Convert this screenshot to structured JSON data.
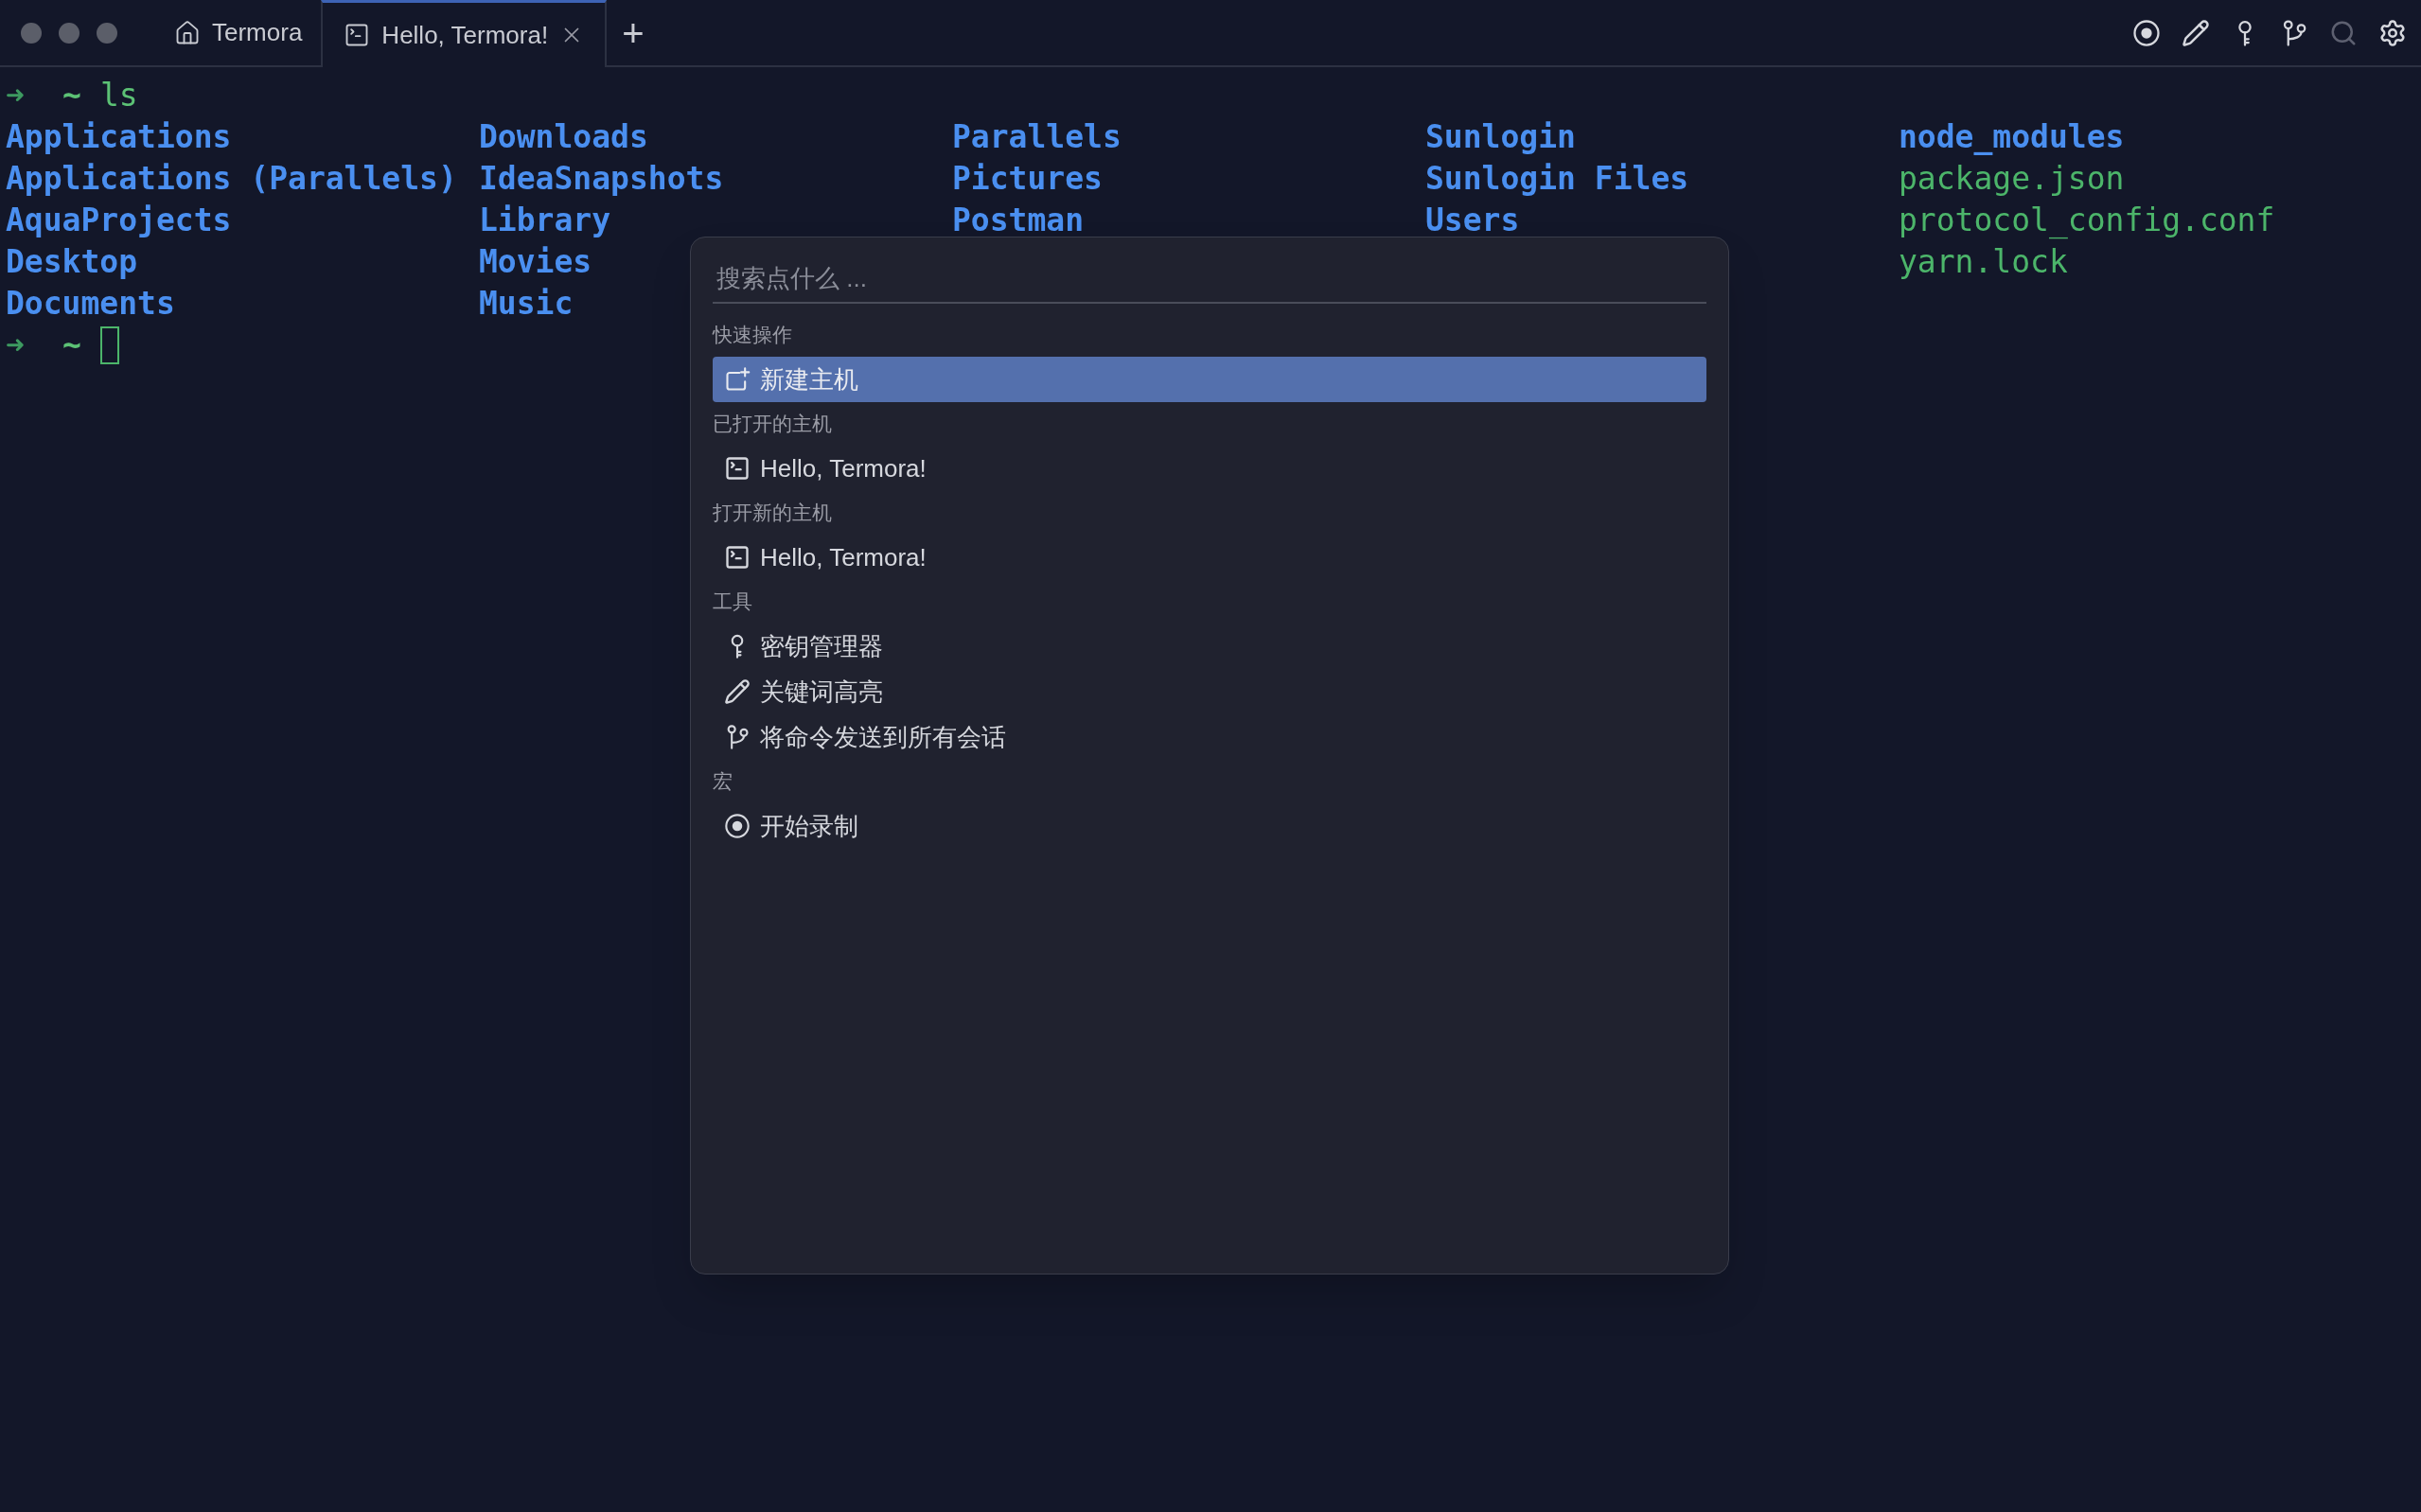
{
  "tabs": [
    {
      "kind": "home",
      "label": "Termora",
      "selected": false
    },
    {
      "kind": "terminal",
      "label": "Hello, Termora!",
      "selected": true,
      "closable": true
    }
  ],
  "new_tab": "+",
  "toolbar": [
    {
      "kind": "record",
      "disabled": false
    },
    {
      "kind": "pencil",
      "disabled": false
    },
    {
      "kind": "key",
      "disabled": false
    },
    {
      "kind": "branch",
      "disabled": false
    },
    {
      "kind": "search",
      "disabled": true
    },
    {
      "kind": "settings",
      "disabled": false
    }
  ],
  "terminal": {
    "prompt_arrow": "➜",
    "prompt_dir": "~",
    "command": "ls",
    "listing": [
      [
        {
          "name": "Applications",
          "kind": "dir"
        },
        {
          "name": "Applications (Parallels)",
          "kind": "dir"
        },
        {
          "name": "AquaProjects",
          "kind": "dir"
        },
        {
          "name": "Desktop",
          "kind": "dir"
        },
        {
          "name": "Documents",
          "kind": "dir"
        }
      ],
      [
        {
          "name": "Downloads",
          "kind": "dir"
        },
        {
          "name": "IdeaSnapshots",
          "kind": "dir"
        },
        {
          "name": "Library",
          "kind": "dir"
        },
        {
          "name": "Movies",
          "kind": "dir"
        },
        {
          "name": "Music",
          "kind": "dir"
        }
      ],
      [
        {
          "name": "Parallels",
          "kind": "dir"
        },
        {
          "name": "Pictures",
          "kind": "dir"
        },
        {
          "name": "Postman",
          "kind": "dir"
        }
      ],
      [
        {
          "name": "Sunlogin",
          "kind": "dir"
        },
        {
          "name": "Sunlogin Files",
          "kind": "dir"
        },
        {
          "name": "Users",
          "kind": "dir"
        }
      ],
      [
        {
          "name": "node_modules",
          "kind": "dir"
        },
        {
          "name": "package.json",
          "kind": "file"
        },
        {
          "name": "protocol_config.conf",
          "kind": "file"
        },
        {
          "name": "yarn.lock",
          "kind": "file"
        }
      ]
    ],
    "next_prompt_arrow": "➜",
    "next_prompt_dir": "~"
  },
  "palette": {
    "search": {
      "placeholder": "搜索点什么 ..."
    },
    "sections": [
      {
        "title": "快速操作",
        "items": [
          {
            "kind": "add",
            "label": "新建主机",
            "selected": true
          }
        ]
      },
      {
        "title": "已打开的主机",
        "items": [
          {
            "kind": "terminal",
            "label": "Hello, Termora!",
            "selected": false
          }
        ]
      },
      {
        "title": "打开新的主机",
        "items": [
          {
            "kind": "terminal",
            "label": "Hello, Termora!",
            "selected": false
          }
        ]
      },
      {
        "title": "工具",
        "items": [
          {
            "kind": "key",
            "label": "密钥管理器",
            "selected": false
          },
          {
            "kind": "pencil",
            "label": "关键词高亮",
            "selected": false
          },
          {
            "kind": "branch",
            "label": "将命令发送到所有会话",
            "selected": false
          }
        ]
      },
      {
        "title": "宏",
        "items": [
          {
            "kind": "record",
            "label": "开始录制",
            "selected": false
          }
        ]
      }
    ]
  }
}
